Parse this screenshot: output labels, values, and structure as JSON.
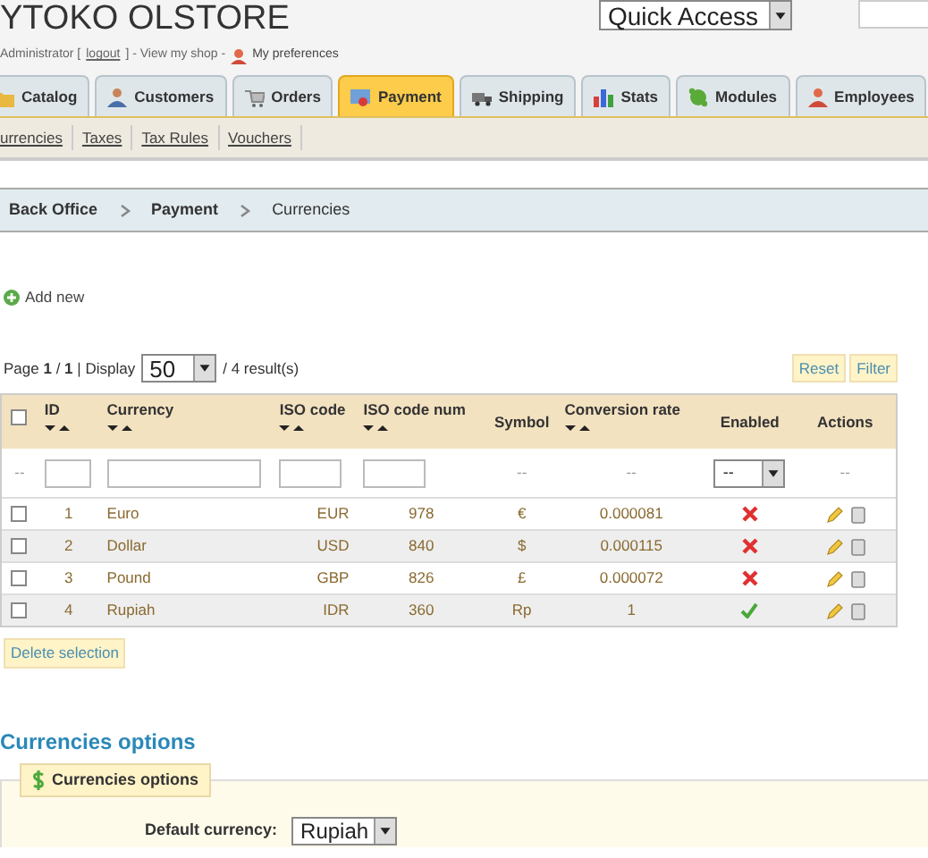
{
  "header": {
    "shop_name": "YTOKO OLSTORE",
    "user": "Administrator [",
    "logout": "logout",
    "after_logout": "] - View my shop -",
    "preferences": "My preferences",
    "quick_access": "Quick Access"
  },
  "tabs": [
    {
      "label": "Catalog",
      "selected": false
    },
    {
      "label": "Customers",
      "selected": false
    },
    {
      "label": "Orders",
      "selected": false
    },
    {
      "label": "Payment",
      "selected": true
    },
    {
      "label": "Shipping",
      "selected": false
    },
    {
      "label": "Stats",
      "selected": false
    },
    {
      "label": "Modules",
      "selected": false
    },
    {
      "label": "Employees",
      "selected": false
    }
  ],
  "subtabs": [
    "urrencies",
    "Taxes",
    "Tax Rules",
    "Vouchers"
  ],
  "breadcrumb": [
    {
      "label": "Back Office",
      "current": false
    },
    {
      "label": "Payment",
      "current": false
    },
    {
      "label": "Currencies",
      "current": true
    }
  ],
  "add_new": "Add new",
  "pagination": {
    "page": "Page",
    "current": "1",
    "sep": "/",
    "total": "1",
    "display": "| Display",
    "per_page": "50",
    "results": "/ 4 result(s)"
  },
  "buttons": [
    "Reset",
    "Filter"
  ],
  "table": {
    "columns": [
      {
        "label": "ID",
        "sortable": true
      },
      {
        "label": "Currency",
        "sortable": true
      },
      {
        "label": "ISO code",
        "sortable": true
      },
      {
        "label": "ISO code num",
        "sortable": true
      },
      {
        "label": "Symbol",
        "sortable": false
      },
      {
        "label": "Conversion rate",
        "sortable": true
      },
      {
        "label": "Enabled",
        "sortable": false
      },
      {
        "label": "Actions",
        "sortable": false
      }
    ],
    "filters": [
      {
        "kind": "input"
      },
      {
        "kind": "input"
      },
      {
        "kind": "input"
      },
      {
        "kind": "input"
      },
      {
        "kind": "dash",
        "text": "--"
      },
      {
        "kind": "dash",
        "text": "--"
      },
      {
        "kind": "select",
        "text": "--"
      },
      {
        "kind": "dash",
        "text": "--"
      }
    ],
    "first_filter": "--",
    "select_all_checked": false,
    "rows": [
      {
        "checked": false,
        "id": "1",
        "currency": "Euro",
        "iso": "EUR",
        "num": "978",
        "symbol": "€",
        "rate": "0.000081",
        "enabled": false
      },
      {
        "checked": false,
        "id": "2",
        "currency": "Dollar",
        "iso": "USD",
        "num": "840",
        "symbol": "$",
        "rate": "0.000115",
        "enabled": false
      },
      {
        "checked": false,
        "id": "3",
        "currency": "Pound",
        "iso": "GBP",
        "num": "826",
        "symbol": "£",
        "rate": "0.000072",
        "enabled": false
      },
      {
        "checked": false,
        "id": "4",
        "currency": "Rupiah",
        "iso": "IDR",
        "num": "360",
        "symbol": "Rp",
        "rate": "1",
        "enabled": true
      }
    ]
  },
  "delete_selection": "Delete selection",
  "options": {
    "heading": "Currencies options",
    "legend": "Currencies options",
    "label": "Default currency:",
    "value": "Rupiah"
  }
}
